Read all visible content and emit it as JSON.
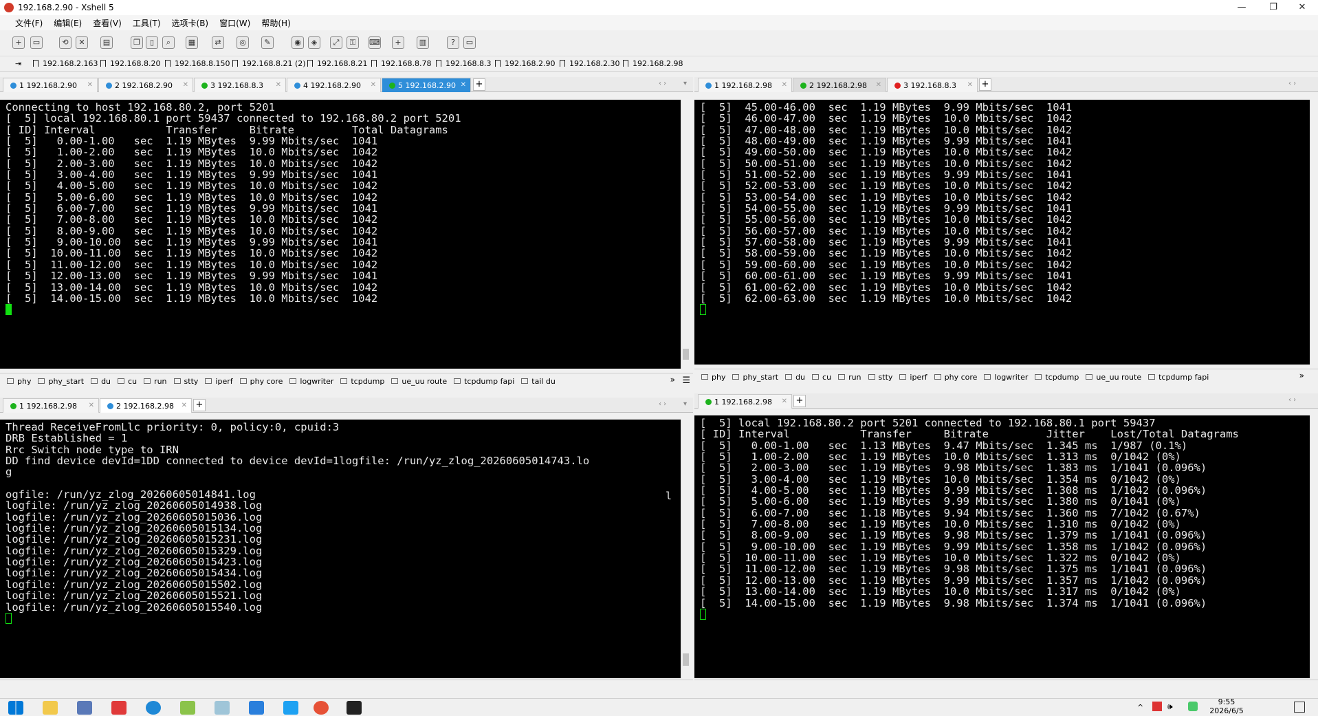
{
  "window": {
    "title": "192.168.2.90 - Xshell 5",
    "controls": [
      "—",
      "❐",
      "✕"
    ]
  },
  "menu": [
    "文件(F)",
    "编辑(E)",
    "查看(V)",
    "工具(T)",
    "选项卡(B)",
    "窗口(W)",
    "帮助(H)"
  ],
  "links": [
    "192.168.2.163",
    "192.168.8.20",
    "192.168.8.150",
    "192.168.8.21 (2)",
    "192.168.8.21",
    "192.168.8.78",
    "192.168.8.3",
    "192.168.2.90",
    "192.168.2.30",
    "192.168.2.98"
  ],
  "colors": {
    "term_bg": "#000000",
    "term_fg": "#e8e8e8",
    "cursor": "#11e011",
    "tab_selected": "#2f8ed9"
  },
  "pane_tl": {
    "tabs": [
      {
        "label": "1 192.168.2.90",
        "dot": "#2f8ed9"
      },
      {
        "label": "2 192.168.2.90",
        "dot": "#2f8ed9"
      },
      {
        "label": "3 192.168.8.3",
        "dot": "#1db31d"
      },
      {
        "label": "4 192.168.2.90",
        "dot": "#2f8ed9"
      },
      {
        "label": "5 192.168.2.90",
        "dot": "#1db31d"
      }
    ],
    "lines": [
      "Connecting to host 192.168.80.2, port 5201",
      "[  5] local 192.168.80.1 port 59437 connected to 192.168.80.2 port 5201",
      "[ ID] Interval           Transfer     Bitrate         Total Datagrams",
      "[  5]   0.00-1.00   sec  1.19 MBytes  9.99 Mbits/sec  1041",
      "[  5]   1.00-2.00   sec  1.19 MBytes  10.0 Mbits/sec  1042",
      "[  5]   2.00-3.00   sec  1.19 MBytes  10.0 Mbits/sec  1042",
      "[  5]   3.00-4.00   sec  1.19 MBytes  9.99 Mbits/sec  1041",
      "[  5]   4.00-5.00   sec  1.19 MBytes  10.0 Mbits/sec  1042",
      "[  5]   5.00-6.00   sec  1.19 MBytes  10.0 Mbits/sec  1042",
      "[  5]   6.00-7.00   sec  1.19 MBytes  9.99 Mbits/sec  1041",
      "[  5]   7.00-8.00   sec  1.19 MBytes  10.0 Mbits/sec  1042",
      "[  5]   8.00-9.00   sec  1.19 MBytes  10.0 Mbits/sec  1042",
      "[  5]   9.00-10.00  sec  1.19 MBytes  9.99 Mbits/sec  1041",
      "[  5]  10.00-11.00  sec  1.19 MBytes  10.0 Mbits/sec  1042",
      "[  5]  11.00-12.00  sec  1.19 MBytes  10.0 Mbits/sec  1042",
      "[  5]  12.00-13.00  sec  1.19 MBytes  9.99 Mbits/sec  1041",
      "[  5]  13.00-14.00  sec  1.19 MBytes  10.0 Mbits/sec  1042",
      "[  5]  14.00-15.00  sec  1.19 MBytes  10.0 Mbits/sec  1042"
    ],
    "quick": [
      "phy",
      "phy_start",
      "du",
      "cu",
      "run",
      "stty",
      "iperf",
      "phy core",
      "logwriter",
      "tcpdump",
      "ue_uu route",
      "tcpdump fapi",
      "tail du"
    ]
  },
  "pane_tr": {
    "tabs": [
      {
        "label": "1 192.168.2.98",
        "dot": "#2f8ed9"
      },
      {
        "label": "2 192.168.2.98",
        "dot": "#1db31d"
      },
      {
        "label": "3 192.168.8.3",
        "dot": "#e02020"
      }
    ],
    "lines": [
      "[  5]  45.00-46.00  sec  1.19 MBytes  9.99 Mbits/sec  1041",
      "[  5]  46.00-47.00  sec  1.19 MBytes  10.0 Mbits/sec  1042",
      "[  5]  47.00-48.00  sec  1.19 MBytes  10.0 Mbits/sec  1042",
      "[  5]  48.00-49.00  sec  1.19 MBytes  9.99 Mbits/sec  1041",
      "[  5]  49.00-50.00  sec  1.19 MBytes  10.0 Mbits/sec  1042",
      "[  5]  50.00-51.00  sec  1.19 MBytes  10.0 Mbits/sec  1042",
      "[  5]  51.00-52.00  sec  1.19 MBytes  9.99 Mbits/sec  1041",
      "[  5]  52.00-53.00  sec  1.19 MBytes  10.0 Mbits/sec  1042",
      "[  5]  53.00-54.00  sec  1.19 MBytes  10.0 Mbits/sec  1042",
      "[  5]  54.00-55.00  sec  1.19 MBytes  9.99 Mbits/sec  1041",
      "[  5]  55.00-56.00  sec  1.19 MBytes  10.0 Mbits/sec  1042",
      "[  5]  56.00-57.00  sec  1.19 MBytes  10.0 Mbits/sec  1042",
      "[  5]  57.00-58.00  sec  1.19 MBytes  9.99 Mbits/sec  1041",
      "[  5]  58.00-59.00  sec  1.19 MBytes  10.0 Mbits/sec  1042",
      "[  5]  59.00-60.00  sec  1.19 MBytes  10.0 Mbits/sec  1042",
      "[  5]  60.00-61.00  sec  1.19 MBytes  9.99 Mbits/sec  1041",
      "[  5]  61.00-62.00  sec  1.19 MBytes  10.0 Mbits/sec  1042",
      "[  5]  62.00-63.00  sec  1.19 MBytes  10.0 Mbits/sec  1042"
    ],
    "quick": [
      "phy",
      "phy_start",
      "du",
      "cu",
      "run",
      "stty",
      "iperf",
      "phy core",
      "logwriter",
      "tcpdump",
      "ue_uu route",
      "tcpdump fapi"
    ]
  },
  "pane_bl": {
    "tabs": [
      {
        "label": "1 192.168.2.98",
        "dot": "#1db31d"
      },
      {
        "label": "2 192.168.2.98",
        "dot": "#2f8ed9"
      }
    ],
    "lines": [
      "Thread ReceiveFromLlc priority: 0, policy:0, cpuid:3",
      "DRB Established = 1",
      "Rrc Switch node type to IRN",
      "DD find device devId=1DD connected to device devId=1logfile: /run/yz_zlog_20260605014743.lo",
      "g",
      "",
      "ogfile: /run/yz_zlog_20260605014841.log",
      "logfile: /run/yz_zlog_20260605014938.log",
      "logfile: /run/yz_zlog_20260605015036.log",
      "logfile: /run/yz_zlog_20260605015134.log",
      "logfile: /run/yz_zlog_20260605015231.log",
      "logfile: /run/yz_zlog_20260605015329.log",
      "logfile: /run/yz_zlog_20260605015423.log",
      "logfile: /run/yz_zlog_20260605015434.log",
      "logfile: /run/yz_zlog_20260605015502.log",
      "logfile: /run/yz_zlog_20260605015521.log",
      "logfile: /run/yz_zlog_20260605015540.log"
    ],
    "stray": "l"
  },
  "pane_br": {
    "tabs": [
      {
        "label": "1 192.168.2.98",
        "dot": "#1db31d"
      }
    ],
    "lines": [
      "[  5] local 192.168.80.2 port 5201 connected to 192.168.80.1 port 59437",
      "[ ID] Interval           Transfer     Bitrate         Jitter    Lost/Total Datagrams",
      "[  5]   0.00-1.00   sec  1.13 MBytes  9.47 Mbits/sec  1.345 ms  1/987 (0.1%)",
      "[  5]   1.00-2.00   sec  1.19 MBytes  10.0 Mbits/sec  1.313 ms  0/1042 (0%)",
      "[  5]   2.00-3.00   sec  1.19 MBytes  9.98 Mbits/sec  1.383 ms  1/1041 (0.096%)",
      "[  5]   3.00-4.00   sec  1.19 MBytes  10.0 Mbits/sec  1.354 ms  0/1042 (0%)",
      "[  5]   4.00-5.00   sec  1.19 MBytes  9.99 Mbits/sec  1.308 ms  1/1042 (0.096%)",
      "[  5]   5.00-6.00   sec  1.19 MBytes  9.99 Mbits/sec  1.380 ms  0/1041 (0%)",
      "[  5]   6.00-7.00   sec  1.18 MBytes  9.94 Mbits/sec  1.360 ms  7/1042 (0.67%)",
      "[  5]   7.00-8.00   sec  1.19 MBytes  10.0 Mbits/sec  1.310 ms  0/1042 (0%)",
      "[  5]   8.00-9.00   sec  1.19 MBytes  9.98 Mbits/sec  1.379 ms  1/1041 (0.096%)",
      "[  5]   9.00-10.00  sec  1.19 MBytes  9.99 Mbits/sec  1.358 ms  1/1042 (0.096%)",
      "[  5]  10.00-11.00  sec  1.19 MBytes  10.0 Mbits/sec  1.322 ms  0/1042 (0%)",
      "[  5]  11.00-12.00  sec  1.19 MBytes  9.98 Mbits/sec  1.375 ms  1/1041 (0.096%)",
      "[  5]  12.00-13.00  sec  1.19 MBytes  9.99 Mbits/sec  1.357 ms  1/1042 (0.096%)",
      "[  5]  13.00-14.00  sec  1.19 MBytes  10.0 Mbits/sec  1.317 ms  0/1042 (0%)",
      "[  5]  14.00-15.00  sec  1.19 MBytes  9.98 Mbits/sec  1.374 ms  1/1041 (0.096%)"
    ]
  },
  "taskbar": {
    "time": "9:55",
    "date": "2026/6/5"
  }
}
